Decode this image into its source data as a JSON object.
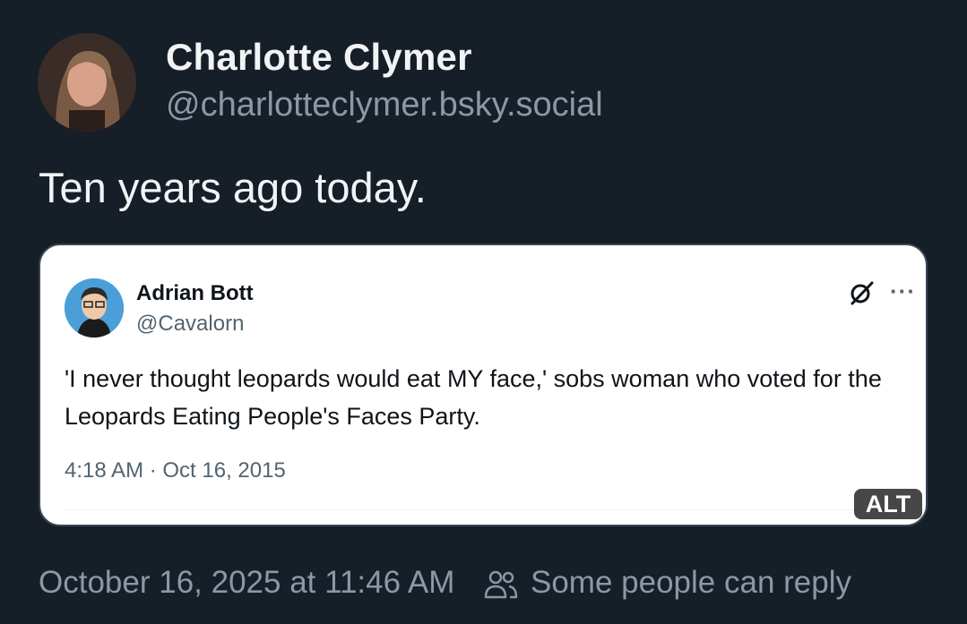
{
  "post": {
    "author": {
      "display_name": "Charlotte Clymer",
      "handle": "@charlotteclymer.bsky.social"
    },
    "text": "Ten years ago today.",
    "timestamp": "October 16, 2025 at 11:46 AM",
    "reply_setting": "Some people can reply"
  },
  "embed": {
    "author": {
      "display_name": "Adrian Bott",
      "handle": "@Cavalorn"
    },
    "text": "'I never thought leopards would eat MY face,' sobs woman who voted for the Leopards Eating People's Faces Party.",
    "timestamp": "4:18 AM · Oct 16, 2015",
    "more_label": "···",
    "alt_label": "ALT"
  },
  "icons": {
    "grok": "grok-icon",
    "more": "more-icon",
    "reply": "people-icon"
  },
  "colors": {
    "background": "#161e27",
    "primary_text": "#f1f3f5",
    "secondary_text": "#8b98a5",
    "embed_background": "#ffffff"
  }
}
